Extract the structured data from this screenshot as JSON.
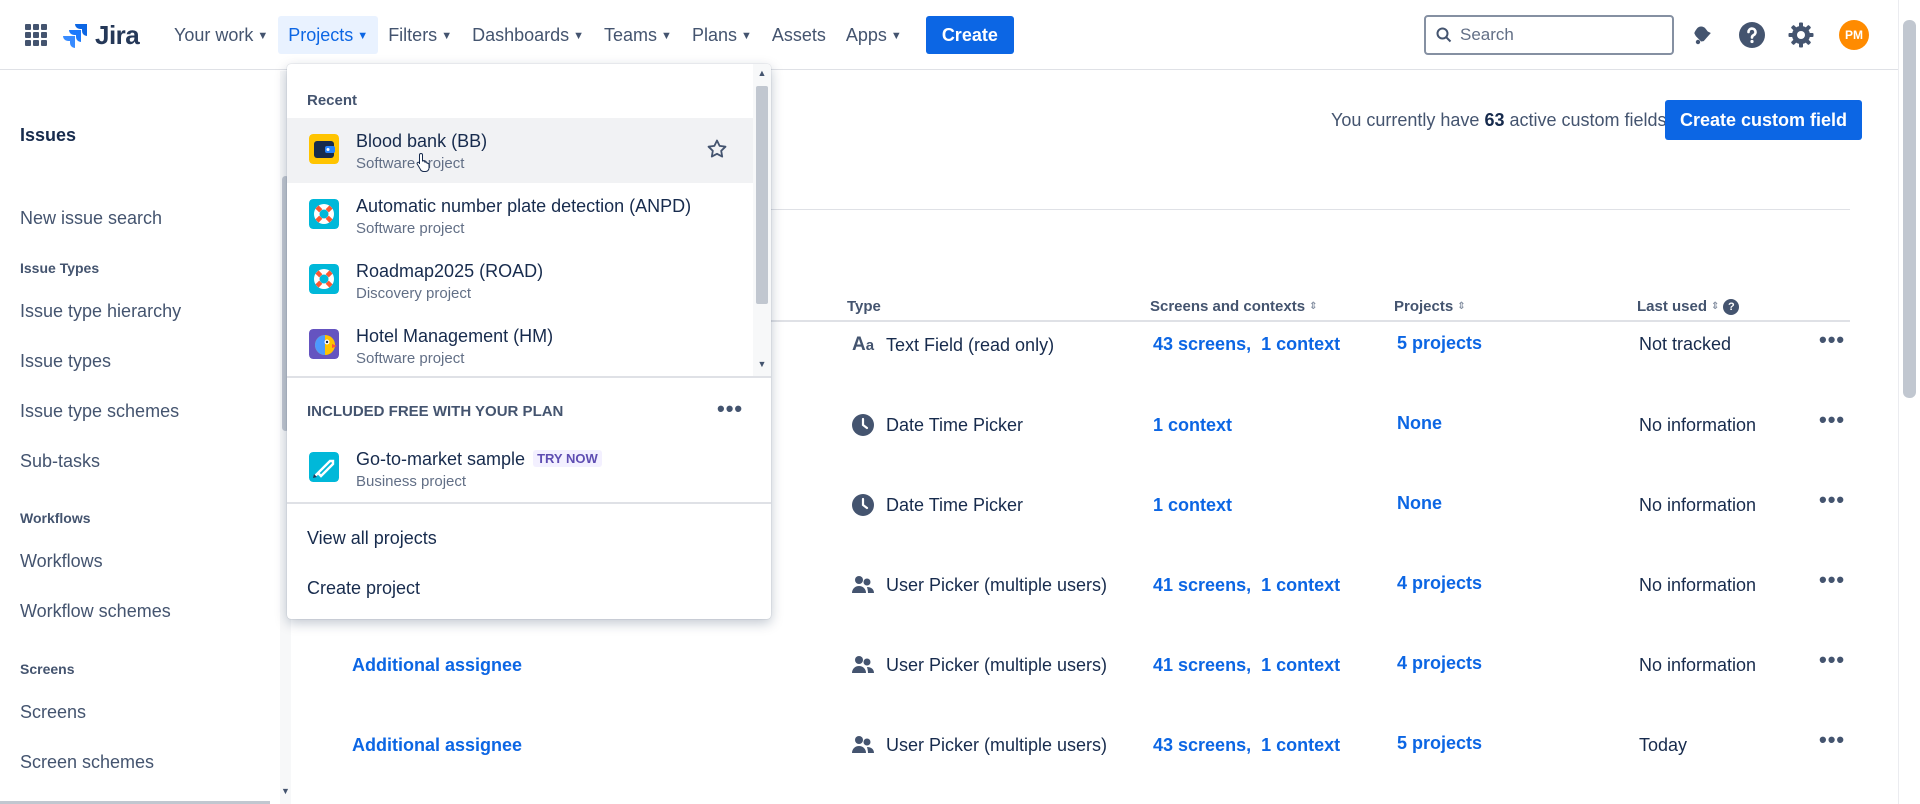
{
  "nav": {
    "logo_text": "Jira",
    "items": [
      {
        "label": "Your work",
        "chevron": true
      },
      {
        "label": "Projects",
        "chevron": true,
        "active": true
      },
      {
        "label": "Filters",
        "chevron": true
      },
      {
        "label": "Dashboards",
        "chevron": true
      },
      {
        "label": "Teams",
        "chevron": true
      },
      {
        "label": "Plans",
        "chevron": true
      },
      {
        "label": "Assets",
        "chevron": false
      },
      {
        "label": "Apps",
        "chevron": true
      }
    ],
    "create_label": "Create",
    "search_placeholder": "Search",
    "avatar_initials": "PM",
    "accent_color": "#0c66e4"
  },
  "sidebar": {
    "title": "Issues",
    "items": [
      {
        "kind": "link",
        "label": "New issue search"
      },
      {
        "kind": "group",
        "label": "Issue Types"
      },
      {
        "kind": "link",
        "label": "Issue type hierarchy"
      },
      {
        "kind": "link",
        "label": "Issue types"
      },
      {
        "kind": "link",
        "label": "Issue type schemes"
      },
      {
        "kind": "link",
        "label": "Sub-tasks"
      },
      {
        "kind": "group",
        "label": "Workflows"
      },
      {
        "kind": "link",
        "label": "Workflows"
      },
      {
        "kind": "link",
        "label": "Workflow schemes"
      },
      {
        "kind": "group",
        "label": "Screens"
      },
      {
        "kind": "link",
        "label": "Screens"
      },
      {
        "kind": "link",
        "label": "Screen schemes"
      }
    ]
  },
  "main": {
    "count_prefix": "You currently have",
    "count_value": "63",
    "count_suffix": "active custom fields",
    "create_field_label": "Create custom field",
    "columns": {
      "type": "Type",
      "screens": "Screens and contexts",
      "projects": "Projects",
      "last_used": "Last used"
    },
    "rows": [
      {
        "name": "",
        "type_icon": "text-aa-icon",
        "type": "Text Field (read only)",
        "screens": "43 screens,",
        "contexts": "1 context",
        "projects": "5 projects",
        "last_used": "Not tracked"
      },
      {
        "name": "",
        "type_icon": "clock-icon",
        "type": "Date Time Picker",
        "screens": "",
        "contexts": "1 context",
        "projects": "None",
        "last_used": "No information"
      },
      {
        "name": "",
        "type_icon": "clock-icon",
        "type": "Date Time Picker",
        "screens": "",
        "contexts": "1 context",
        "projects": "None",
        "last_used": "No information"
      },
      {
        "name": "",
        "type_icon": "users-icon",
        "type": "User Picker (multiple users)",
        "screens": "41 screens,",
        "contexts": "1 context",
        "projects": "4 projects",
        "last_used": "No information"
      },
      {
        "name": "Additional assignee",
        "type_icon": "users-icon",
        "type": "User Picker (multiple users)",
        "screens": "41 screens,",
        "contexts": "1 context",
        "projects": "4 projects",
        "last_used": "No information"
      },
      {
        "name": "Additional assignee",
        "type_icon": "users-icon",
        "type": "User Picker (multiple users)",
        "screens": "43 screens,",
        "contexts": "1 context",
        "projects": "5 projects",
        "last_used": "Today"
      }
    ]
  },
  "dropdown": {
    "recent_heading": "Recent",
    "recent": [
      {
        "name": "Blood bank (BB)",
        "type": "Software project",
        "icon": "wallet-icon",
        "icon_color": "#ffc400"
      },
      {
        "name": "Automatic number plate detection (ANPD)",
        "type": "Software project",
        "icon": "lifebuoy-icon",
        "icon_color": "#00b8d9"
      },
      {
        "name": "Roadmap2025 (ROAD)",
        "type": "Discovery project",
        "icon": "lifebuoy-icon",
        "icon_color": "#00b8d9"
      },
      {
        "name": "Hotel Management (HM)",
        "type": "Software project",
        "icon": "parrot-icon",
        "icon_color": "#6554c0"
      }
    ],
    "included_heading": "INCLUDED FREE WITH YOUR PLAN",
    "sample": {
      "name": "Go-to-market sample",
      "badge": "TRY NOW",
      "type": "Business project",
      "icon": "rocket-icon",
      "icon_color": "#00b8d9"
    },
    "view_all": "View all projects",
    "create_project": "Create project"
  }
}
